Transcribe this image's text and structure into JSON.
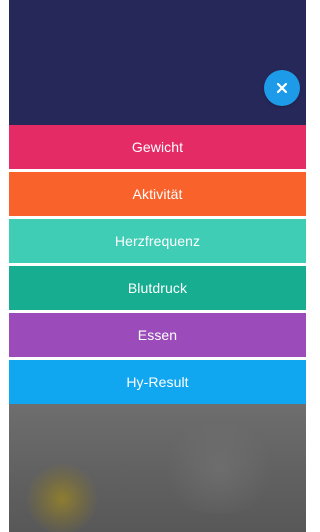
{
  "header": {
    "background_color": "#27285a"
  },
  "close_button": {
    "icon": "close-icon",
    "color": "#1e9be8"
  },
  "menu": {
    "items": [
      {
        "label": "Gewicht",
        "color": "#e42b66"
      },
      {
        "label": "Aktivität",
        "color": "#f9622a"
      },
      {
        "label": "Herzfrequenz",
        "color": "#3fcdb6"
      },
      {
        "label": "Blutdruck",
        "color": "#16ad90"
      },
      {
        "label": "Essen",
        "color": "#9b4cba"
      },
      {
        "label": "Hy-Result",
        "color": "#11a6f0"
      }
    ]
  }
}
